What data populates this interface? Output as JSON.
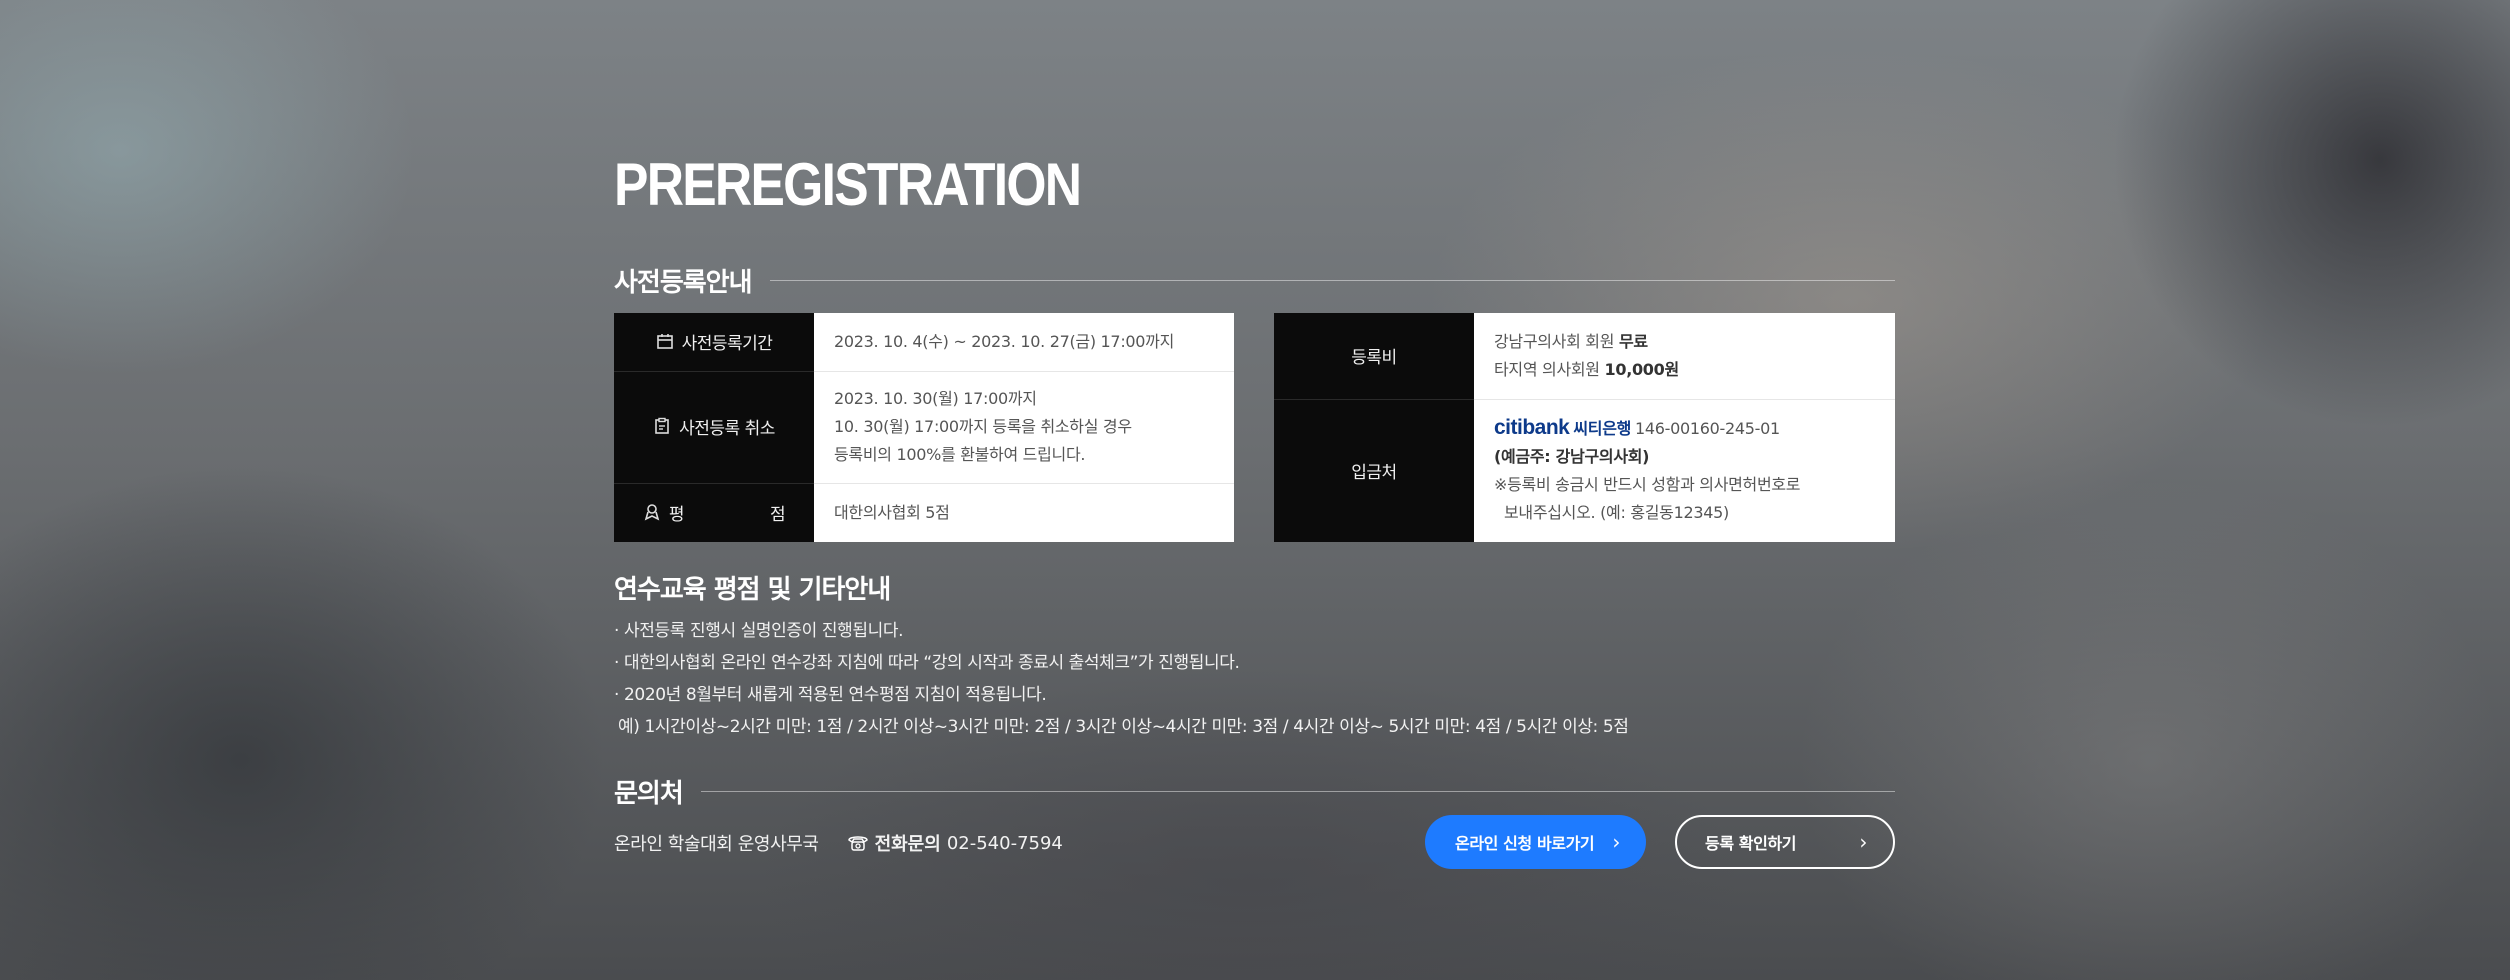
{
  "hero": {
    "title": "PREREGISTRATION"
  },
  "sections": {
    "prereg": "사전등록안내",
    "cme": "연수교육 평점 및 기타안내",
    "contact": "문의처"
  },
  "left_table": {
    "period_label": "사전등록기간",
    "period_value": "2023. 10. 4(수) ~ 2023. 10. 27(금) 17:00까지",
    "cancel_label": "사전등록 취소",
    "cancel_lines": [
      "2023. 10. 30(월) 17:00까지",
      "10. 30(월) 17:00까지 등록을 취소하실 경우",
      "등록비의 100%를 환불하여 드립니다."
    ],
    "score_label_a": "평",
    "score_label_b": "점",
    "score_value": "대한의사협회 5점"
  },
  "right_table": {
    "fee_label": "등록비",
    "fee_line1_text": "강남구의사회 회원",
    "fee_line1_strong": "무료",
    "fee_line2_text": "타지역 의사회원",
    "fee_line2_strong": "10,000원",
    "deposit_label": "입금처",
    "bank_logo_text": "citibank",
    "bank_name": "씨티은행",
    "account_number": "146-00160-245-01",
    "holder": "(예금주: 강남구의사회)",
    "note_line1": "※등록비 송금시 반드시 성함과 의사면허번호로",
    "note_line2": "보내주십시오. (예: 홍길동12345)"
  },
  "notes": [
    "· 사전등록 진행시 실명인증이 진행됩니다.",
    "· 대한의사협회 온라인 연수강좌 지침에 따라 “강의 시작과 종료시 출석체크”가 진행됩니다.",
    "· 2020년 8월부터 새롭게 적용된 연수평점 지침이 적용됩니다.",
    "예) 1시간이상~2시간 미만: 1점 / 2시간 이상~3시간 미만: 2점 / 3시간 이상~4시간 미만: 3점 / 4시간 이상~ 5시간 미만: 4점 / 5시간 이상: 5점"
  ],
  "contact": {
    "org": "온라인 학술대회 운영사무국",
    "phone_label": "전화문의",
    "phone": "02-540-7594"
  },
  "buttons": {
    "apply": "온라인 신청 바로가기",
    "confirm": "등록 확인하기"
  },
  "colors": {
    "accent": "#1e7bff",
    "table_header": "#0b0b0b",
    "citi_blue": "#0d3a8a",
    "citi_red": "#e21e26"
  }
}
